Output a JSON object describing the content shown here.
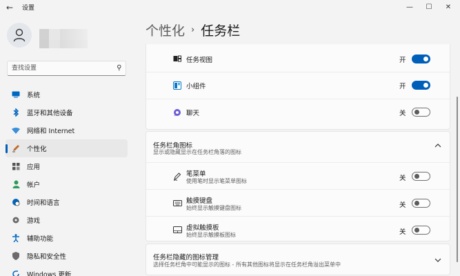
{
  "window": {
    "title": "设置",
    "back_glyph": "←",
    "minimize_glyph": "—",
    "maximize_glyph": "☐",
    "close_glyph": "✕"
  },
  "search": {
    "placeholder": "查找设置"
  },
  "sidebar": {
    "items": [
      {
        "label": "系统",
        "icon": "monitor-icon",
        "color": "#0067c0"
      },
      {
        "label": "蓝牙和其他设备",
        "icon": "bluetooth-icon",
        "color": "#0067c0"
      },
      {
        "label": "网络和 Internet",
        "icon": "wifi-icon",
        "color": "#3b8fd9"
      },
      {
        "label": "个性化",
        "icon": "pen-icon",
        "color": "#c06a2e",
        "active": true
      },
      {
        "label": "应用",
        "icon": "apps-icon",
        "color": "#555555"
      },
      {
        "label": "帐户",
        "icon": "person-icon",
        "color": "#2e9a5a"
      },
      {
        "label": "时间和语言",
        "icon": "globe-clock-icon",
        "color": "#0067c0"
      },
      {
        "label": "游戏",
        "icon": "gamepad-icon",
        "color": "#6b6b6b"
      },
      {
        "label": "辅助功能",
        "icon": "accessibility-icon",
        "color": "#0067c0"
      },
      {
        "label": "隐私和安全性",
        "icon": "shield-icon",
        "color": "#6b6b6b"
      },
      {
        "label": "Windows 更新",
        "icon": "update-icon",
        "color": "#0067c0"
      }
    ]
  },
  "header": {
    "parent": "个性化",
    "separator": "›",
    "current": "任务栏"
  },
  "taskbar_items": [
    {
      "title": "任务视图",
      "icon": "task-view-icon",
      "state": "开",
      "on": true
    },
    {
      "title": "小组件",
      "icon": "widgets-icon",
      "state": "开",
      "on": true
    },
    {
      "title": "聊天",
      "icon": "chat-icon",
      "state": "关",
      "on": false
    }
  ],
  "corner_icons": {
    "title": "任务栏角图标",
    "subtitle": "显示或隐藏显示在任务栏角落的图标",
    "items": [
      {
        "title": "笔菜单",
        "subtitle": "使用笔时显示笔菜单图标",
        "icon": "pen-menu-icon",
        "state": "关",
        "on": false
      },
      {
        "title": "触摸键盘",
        "subtitle": "始终显示触摸键盘图标",
        "icon": "keyboard-icon",
        "state": "关",
        "on": false
      },
      {
        "title": "虚拟触摸板",
        "subtitle": "始终显示触摸板图标",
        "icon": "touchpad-icon",
        "state": "关",
        "on": false
      }
    ]
  },
  "overflow": {
    "title": "任务栏隐藏的图标管理",
    "subtitle": "选择任务栏角中可能显示的图标 - 所有其他图标将显示在任务栏角溢出菜单中"
  }
}
